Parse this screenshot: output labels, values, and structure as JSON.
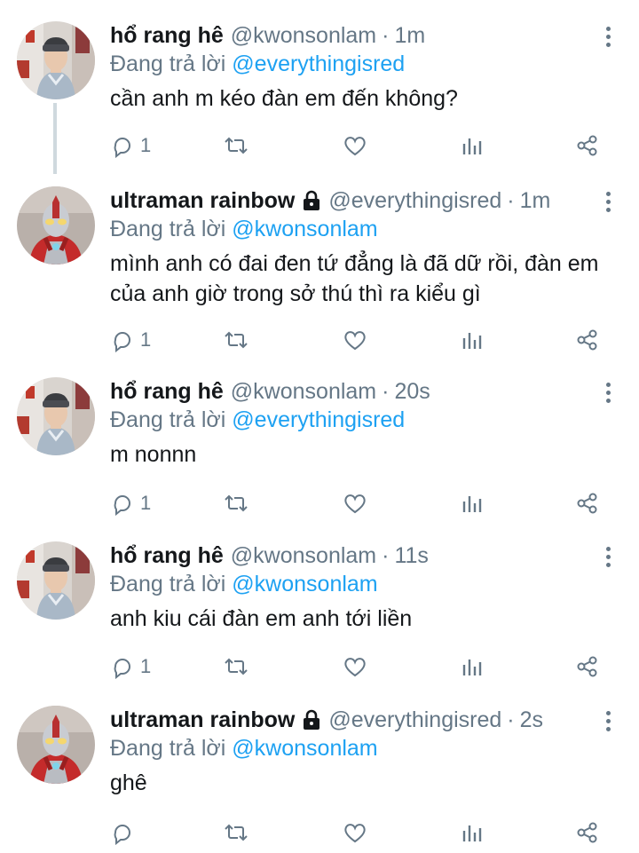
{
  "reply_prefix": "Đang trả lời",
  "tweets": [
    {
      "name": "hổ rang hê",
      "locked": false,
      "handle": "@kwonsonlam",
      "time": "1m",
      "reply_to": "@everythingisred",
      "text": "cần anh m kéo đàn em đến không?",
      "reply_count": "1",
      "avatar": "person-avatar"
    },
    {
      "name": "ultraman rainbow",
      "locked": true,
      "handle": "@everythingisred",
      "time": "1m",
      "reply_to": "@kwonsonlam",
      "text": "mình anh có đai đen tứ đẳng là đã dữ rồi, đàn em của anh giờ trong sở thú thì ra kiểu gì",
      "reply_count": "1",
      "avatar": "ultraman-avatar"
    },
    {
      "name": "hổ rang hê",
      "locked": false,
      "handle": "@kwonsonlam",
      "time": "20s",
      "reply_to": "@everythingisred",
      "text": "m nonnn",
      "reply_count": "1",
      "avatar": "person-avatar"
    },
    {
      "name": "hổ rang hê",
      "locked": false,
      "handle": "@kwonsonlam",
      "time": "11s",
      "reply_to": "@kwonsonlam",
      "text": "anh kiu cái đàn em anh tới liền",
      "reply_count": "1",
      "avatar": "person-avatar"
    },
    {
      "name": "ultraman rainbow",
      "locked": true,
      "handle": "@everythingisred",
      "time": "2s",
      "reply_to": "@kwonsonlam",
      "text": "ghê",
      "reply_count": "",
      "avatar": "ultraman-avatar"
    }
  ],
  "colors": {
    "text": "#14171a",
    "secondary": "#657786",
    "link": "#1da1f2",
    "thread_line": "#cfd9de"
  }
}
